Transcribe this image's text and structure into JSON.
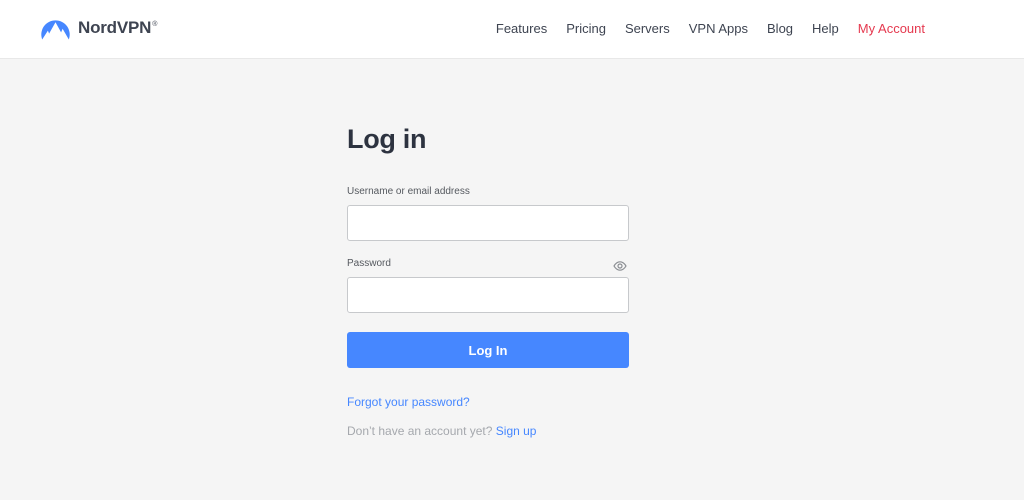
{
  "header": {
    "logo_text": "NordVPN",
    "logo_reg": "®",
    "nav": [
      {
        "label": "Features"
      },
      {
        "label": "Pricing"
      },
      {
        "label": "Servers"
      },
      {
        "label": "VPN Apps"
      },
      {
        "label": "Blog"
      },
      {
        "label": "Help"
      },
      {
        "label": "My Account"
      }
    ]
  },
  "login": {
    "title": "Log in",
    "username_label": "Username or email address",
    "username_value": "",
    "password_label": "Password",
    "password_value": "",
    "submit_label": "Log In",
    "forgot_label": "Forgot your password?",
    "signup_prompt": "Don’t have an account yet?",
    "signup_label": "Sign up"
  },
  "colors": {
    "brand_blue": "#4687ff",
    "account_red": "#e5394f",
    "background": "#f5f5f5",
    "header_bg": "#ffffff"
  },
  "icons": {
    "logo": "nordvpn-mountain-icon",
    "password_toggle": "eye-icon"
  }
}
